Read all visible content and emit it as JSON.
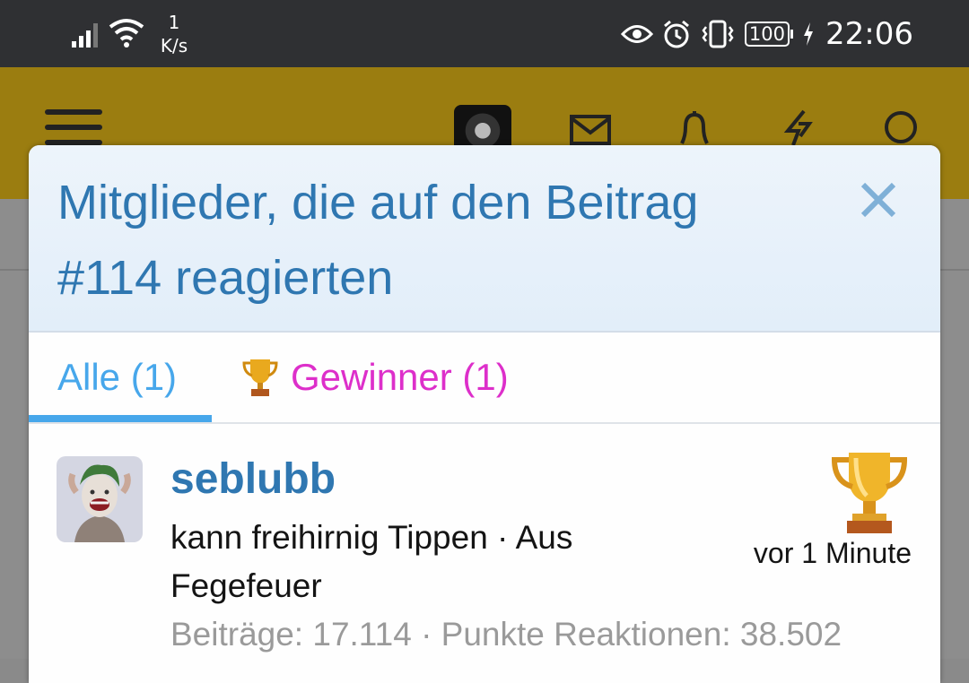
{
  "status_bar": {
    "net_speed_value": "1",
    "net_speed_unit": "K/s",
    "battery": "100",
    "time": "22:06",
    "icons": [
      "signal-icon",
      "wifi-icon",
      "eye-icon",
      "alarm-icon",
      "vibrate-icon",
      "battery-icon",
      "charging-icon"
    ]
  },
  "header": {
    "icons": [
      "menu-icon",
      "user-avatar",
      "mail-icon",
      "bell-icon",
      "bolt-icon",
      "search-icon"
    ],
    "color": "#9b7d10"
  },
  "modal": {
    "title": "Mitglieder, die auf den Beitrag #114 reagierten",
    "close_icon": "close-icon",
    "tabs": [
      {
        "label": "Alle (1)",
        "active": true
      },
      {
        "label": "Gewinner (1)",
        "icon": "trophy-icon",
        "active": false
      }
    ]
  },
  "members": [
    {
      "name": "seblubb",
      "title": "kann freihirnig Tippen · Aus Fegefeuer",
      "stats": "Beiträge: 17.114 · Punkte Reaktionen: 38.502",
      "reaction": "trophy-icon",
      "time": "vor 1 Minute"
    }
  ],
  "colors": {
    "title_blue": "#2f77b1",
    "tab_active": "#47a7eb",
    "tab_winner": "#dd2fca",
    "muted": "#9a9a9a"
  }
}
